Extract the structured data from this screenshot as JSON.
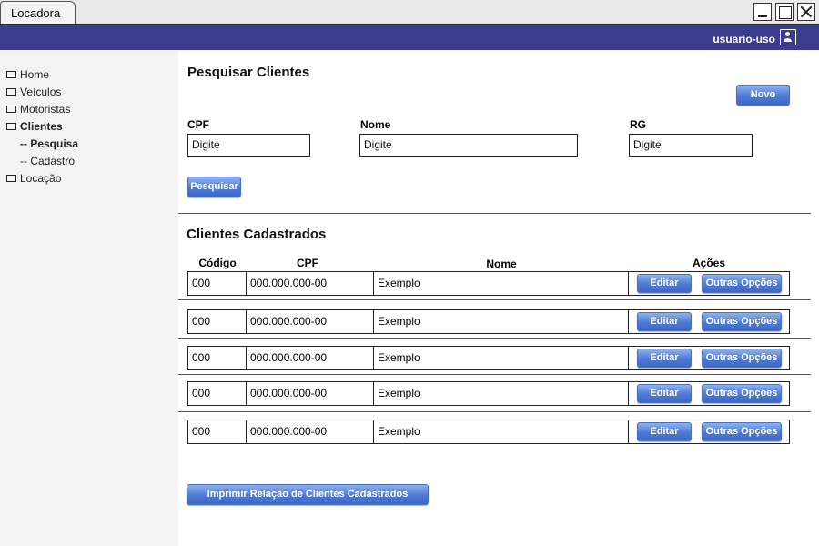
{
  "window": {
    "tab_title": "Locadora"
  },
  "header": {
    "username": "usuario-uso"
  },
  "sidebar": {
    "items": [
      {
        "label": "Home"
      },
      {
        "label": "Veículos"
      },
      {
        "label": "Motoristas"
      },
      {
        "label": "Clientes"
      }
    ],
    "subitems": [
      {
        "label": "-- Pesquisa"
      },
      {
        "label": "-- Cadastro"
      }
    ],
    "last_item": {
      "label": "Locação"
    }
  },
  "search": {
    "title": "Pesquisar Clientes",
    "new_button": "Novo",
    "fields": {
      "cpf": {
        "label": "CPF",
        "value": "Digite"
      },
      "nome": {
        "label": "Nome",
        "value": "Digite"
      },
      "rg": {
        "label": "RG",
        "value": "Digite"
      }
    },
    "search_button": "Pesquisar"
  },
  "clients": {
    "title": "Clientes Cadastrados",
    "columns": {
      "code": "Código",
      "cpf": "CPF",
      "name": "Nome",
      "actions": "Ações"
    },
    "edit_label": "Editar",
    "more_label": "Outras Opções",
    "rows": [
      {
        "code": "000",
        "cpf": "000.000.000-00",
        "name": "Exemplo"
      },
      {
        "code": "000",
        "cpf": "000.000.000-00",
        "name": "Exemplo"
      },
      {
        "code": "000",
        "cpf": "000.000.000-00",
        "name": "Exemplo"
      },
      {
        "code": "000",
        "cpf": "000.000.000-00",
        "name": "Exemplo"
      },
      {
        "code": "000",
        "cpf": "000.000.000-00",
        "name": "Exemplo"
      }
    ],
    "print_button": "Imprimir Relação de Clientes Cadastrados"
  }
}
